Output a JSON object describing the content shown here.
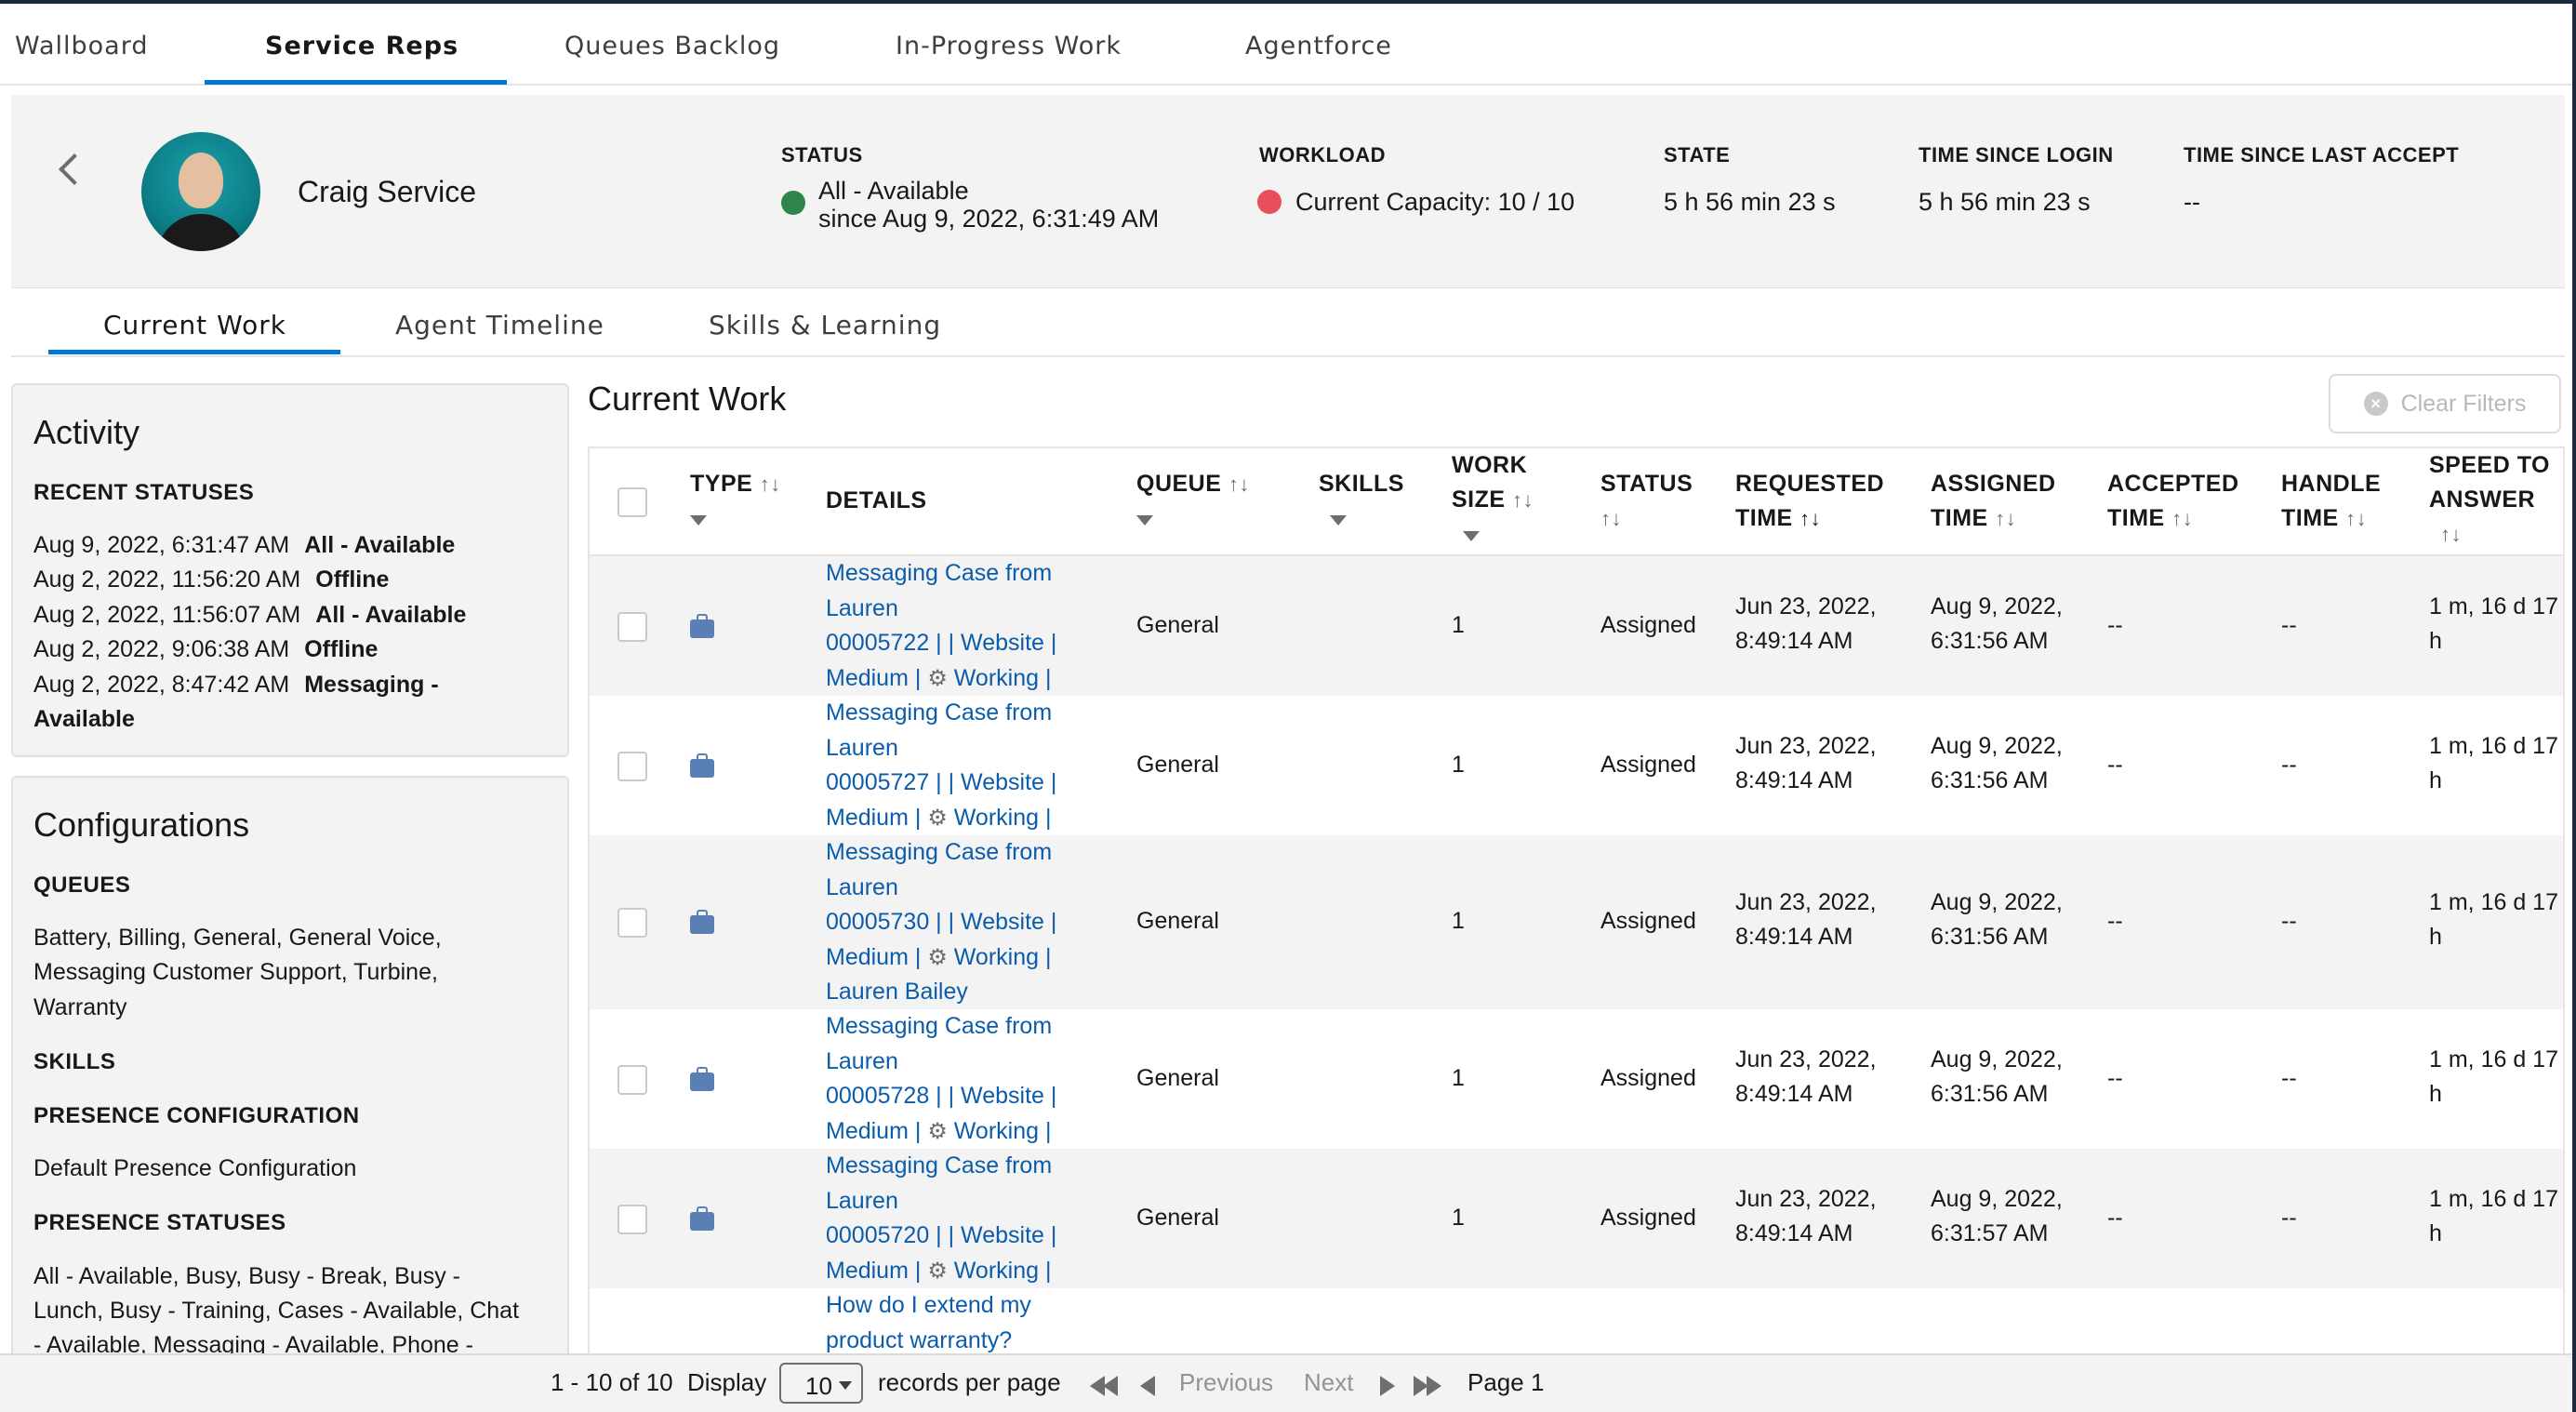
{
  "top_tabs": [
    "Wallboard",
    "Service Reps",
    "Queues Backlog",
    "In-Progress Work",
    "Agentforce"
  ],
  "agent": {
    "name": "Craig Service"
  },
  "header": {
    "status_label": "STATUS",
    "status_value": "All - Available",
    "status_since": "since  Aug 9, 2022, 6:31:49 AM",
    "status_color": "#2e844a",
    "workload_label": "WORKLOAD",
    "workload_value": "Current Capacity:  10 / 10",
    "workload_color": "#ea4d5c",
    "state_label": "STATE",
    "state_value": "5 h 56 min 23 s",
    "login_label": "TIME SINCE LOGIN",
    "login_value": "5 h 56 min 23 s",
    "accept_label": "TIME SINCE LAST ACCEPT",
    "accept_value": "--"
  },
  "sub_tabs": [
    "Current Work",
    "Agent Timeline",
    "Skills & Learning"
  ],
  "activity": {
    "title": "Activity",
    "recent_label": "RECENT STATUSES",
    "statuses": [
      {
        "time": "Aug 9, 2022, 6:31:47 AM",
        "status": "All - Available"
      },
      {
        "time": "Aug 2, 2022, 11:56:20 AM",
        "status": "Offline"
      },
      {
        "time": "Aug 2, 2022, 11:56:07 AM",
        "status": "All - Available"
      },
      {
        "time": "Aug 2, 2022, 9:06:38 AM",
        "status": "Offline"
      },
      {
        "time": "Aug 2, 2022, 8:47:42 AM",
        "status": "Messaging -"
      }
    ],
    "status_wrap": "Available"
  },
  "configurations": {
    "title": "Configurations",
    "queues_label": "QUEUES",
    "queues_line1": "Battery, Billing, General, General Voice,",
    "queues_line2": "Messaging Customer Support, Turbine,",
    "queues_line3": "Warranty",
    "skills_label": "SKILLS",
    "presence_config_label": "PRESENCE CONFIGURATION",
    "presence_config_value": "Default Presence Configuration",
    "presence_statuses_label": "PRESENCE STATUSES",
    "presence_line1": "All - Available, Busy, Busy - Break, Busy -",
    "presence_line2": "Lunch, Busy - Training, Cases - Available, Chat",
    "presence_line3": "- Available, Messaging - Available, Phone -"
  },
  "main": {
    "title": "Current Work",
    "clear_filters": "Clear Filters",
    "columns": {
      "type": "TYPE",
      "details": "DETAILS",
      "queue": "QUEUE",
      "skills": "SKILLS",
      "work_size_1": "WORK",
      "work_size_2": "SIZE",
      "status": "STATUS",
      "requested_1": "REQUESTED",
      "requested_2": "TIME",
      "assigned_1": "ASSIGNED",
      "assigned_2": "TIME",
      "accepted_1": "ACCEPTED",
      "accepted_2": "TIME",
      "handle_1": "HANDLE",
      "handle_2": "TIME",
      "speed_1": "SPEED TO",
      "speed_2": "ANSWER"
    },
    "rows": [
      {
        "d1": "Messaging Case from",
        "d2": "Lauren",
        "d3": "00005722 | | Website |",
        "d4": "Medium | ",
        "d4b": " Working |",
        "d5": "",
        "queue": "General",
        "size": "1",
        "status": "Assigned",
        "req1": "Jun 23, 2022,",
        "req2": "8:49:14 AM",
        "asg1": "Aug 9, 2022,",
        "asg2": "6:31:56 AM",
        "acc": "--",
        "hnd": "--",
        "spd1": "1 m, 16 d 17",
        "spd2": "h"
      },
      {
        "d1": "Messaging Case from",
        "d2": "Lauren",
        "d3": "00005727 | | Website |",
        "d4": "Medium | ",
        "d4b": " Working |",
        "d5": "",
        "queue": "General",
        "size": "1",
        "status": "Assigned",
        "req1": "Jun 23, 2022,",
        "req2": "8:49:14 AM",
        "asg1": "Aug 9, 2022,",
        "asg2": "6:31:56 AM",
        "acc": "--",
        "hnd": "--",
        "spd1": "1 m, 16 d 17",
        "spd2": "h"
      },
      {
        "d1": "Messaging Case from",
        "d2": "Lauren",
        "d3": "00005730 | | Website |",
        "d4": "Medium | ",
        "d4b": " Working |",
        "d5": "Lauren Bailey",
        "queue": "General",
        "size": "1",
        "status": "Assigned",
        "req1": "Jun 23, 2022,",
        "req2": "8:49:14 AM",
        "asg1": "Aug 9, 2022,",
        "asg2": "6:31:56 AM",
        "acc": "--",
        "hnd": "--",
        "spd1": "1 m, 16 d 17",
        "spd2": "h"
      },
      {
        "d1": "Messaging Case from",
        "d2": "Lauren",
        "d3": "00005728 | | Website |",
        "d4": "Medium | ",
        "d4b": " Working |",
        "d5": "",
        "queue": "General",
        "size": "1",
        "status": "Assigned",
        "req1": "Jun 23, 2022,",
        "req2": "8:49:14 AM",
        "asg1": "Aug 9, 2022,",
        "asg2": "6:31:56 AM",
        "acc": "--",
        "hnd": "--",
        "spd1": "1 m, 16 d 17",
        "spd2": "h"
      },
      {
        "d1": "Messaging Case from",
        "d2": "Lauren",
        "d3": "00005720 | | Website |",
        "d4": "Medium | ",
        "d4b": " Working |",
        "d5": "",
        "queue": "General",
        "size": "1",
        "status": "Assigned",
        "req1": "Jun 23, 2022,",
        "req2": "8:49:14 AM",
        "asg1": "Aug 9, 2022,",
        "asg2": "6:31:57 AM",
        "acc": "--",
        "hnd": "--",
        "spd1": "1 m, 16 d 17",
        "spd2": "h"
      }
    ],
    "partial_row": {
      "d1": "How do I extend my",
      "d2": "product warranty?"
    }
  },
  "footer": {
    "range": "1 - 10 of 10",
    "display": "Display",
    "per_page_value": "10",
    "records_per_page": "records per page",
    "previous": "Previous",
    "next": "Next",
    "page": "Page 1"
  },
  "icons": {
    "back": "chevron-left-icon",
    "case": "briefcase-icon",
    "gear": "gear-icon",
    "clear": "close-circle-icon"
  }
}
